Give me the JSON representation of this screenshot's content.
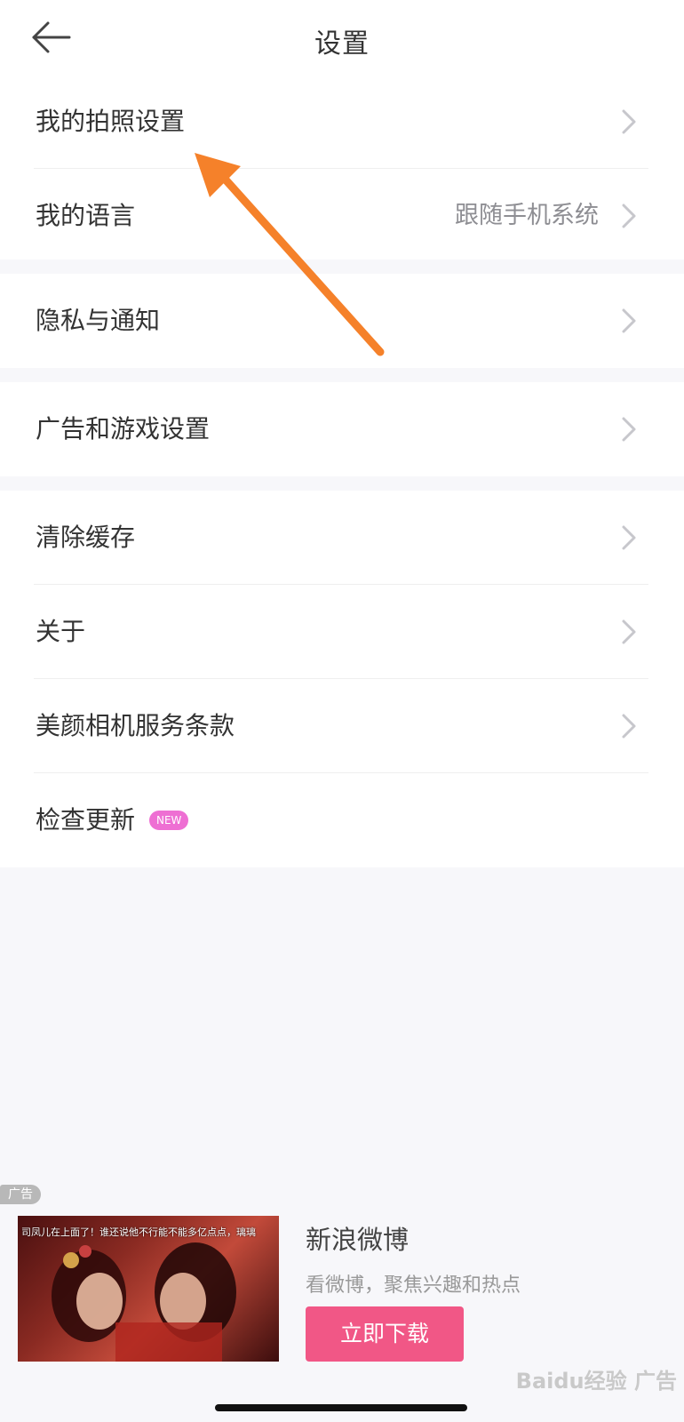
{
  "header": {
    "title": "设置",
    "back_icon": "arrow-left-icon"
  },
  "groups": [
    {
      "items": [
        {
          "label": "我的拍照设置",
          "value": ""
        },
        {
          "label": "我的语言",
          "value": "跟随手机系统"
        }
      ]
    },
    {
      "items": [
        {
          "label": "隐私与通知",
          "value": ""
        }
      ]
    },
    {
      "items": [
        {
          "label": "广告和游戏设置",
          "value": ""
        }
      ]
    },
    {
      "items": [
        {
          "label": "清除缓存",
          "value": ""
        },
        {
          "label": "关于",
          "value": ""
        },
        {
          "label": "美颜相机服务条款",
          "value": ""
        },
        {
          "label": "检查更新",
          "badge": "NEW"
        }
      ]
    }
  ],
  "ad": {
    "tag": "广告",
    "image_caption": "司凤儿在上面了！谁还说他不行能不能多亿点点，璃璃",
    "title": "新浪微博",
    "subtitle": "看微博，聚焦兴趣和热点",
    "button_label": "立即下载"
  },
  "watermark": "Baidu经验 广告",
  "colors": {
    "accent_pink": "#f15786",
    "badge_pink": "#ee6fd3",
    "annotation_arrow": "#f5812a"
  }
}
